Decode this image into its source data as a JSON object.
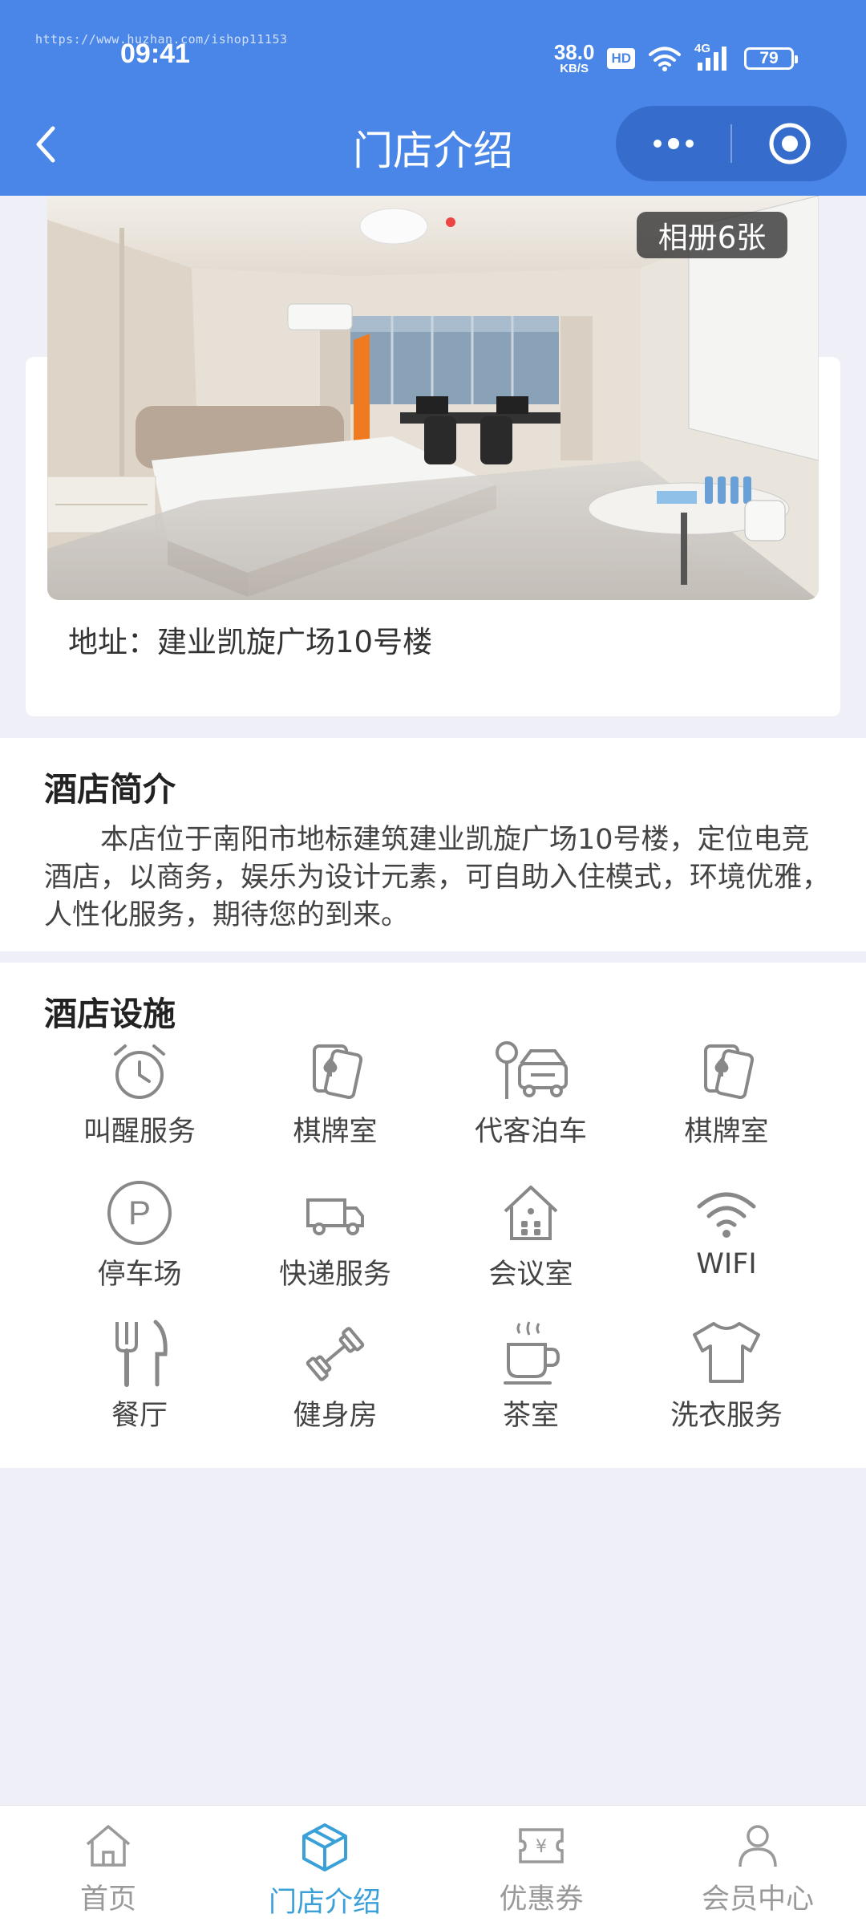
{
  "status_bar": {
    "watermark": "https://www.huzhan.com/ishop11153",
    "time": "09:41",
    "net_speed": "38.0",
    "net_unit": "KB/S",
    "hd": "HD",
    "signal": "4G",
    "battery": "79"
  },
  "nav": {
    "title": "门店介绍"
  },
  "store": {
    "album_label": "相册6张",
    "address": "地址：建业凯旋广场10号楼"
  },
  "intro": {
    "title": "酒店简介",
    "text": "本店位于南阳市地标建筑建业凯旋广场10号楼，定位电竞酒店，以商务，娱乐为设计元素，可自助入住模式，环境优雅，人性化服务，期待您的到来。"
  },
  "facilities": {
    "title": "酒店设施",
    "items": [
      {
        "label": "叫醒服务",
        "icon": "alarm-clock-icon"
      },
      {
        "label": "棋牌室",
        "icon": "playing-cards-icon"
      },
      {
        "label": "代客泊车",
        "icon": "valet-parking-icon"
      },
      {
        "label": "棋牌室",
        "icon": "playing-cards-icon"
      },
      {
        "label": "停车场",
        "icon": "parking-icon"
      },
      {
        "label": "快递服务",
        "icon": "delivery-truck-icon"
      },
      {
        "label": "会议室",
        "icon": "meeting-room-icon"
      },
      {
        "label": "WIFI",
        "icon": "wifi-icon"
      },
      {
        "label": "餐厅",
        "icon": "restaurant-icon"
      },
      {
        "label": "健身房",
        "icon": "dumbbell-icon"
      },
      {
        "label": "茶室",
        "icon": "tea-cup-icon"
      },
      {
        "label": "洗衣服务",
        "icon": "laundry-shirt-icon"
      }
    ]
  },
  "tabbar": {
    "items": [
      {
        "label": "首页",
        "icon": "home-icon"
      },
      {
        "label": "门店介绍",
        "icon": "store-cube-icon",
        "active": true
      },
      {
        "label": "优惠券",
        "icon": "coupon-icon"
      },
      {
        "label": "会员中心",
        "icon": "user-icon"
      }
    ],
    "active_color": "#3aa0d8",
    "inactive_color": "#999999"
  },
  "colors": {
    "header": "#4a86e8",
    "background": "#efeff7"
  }
}
